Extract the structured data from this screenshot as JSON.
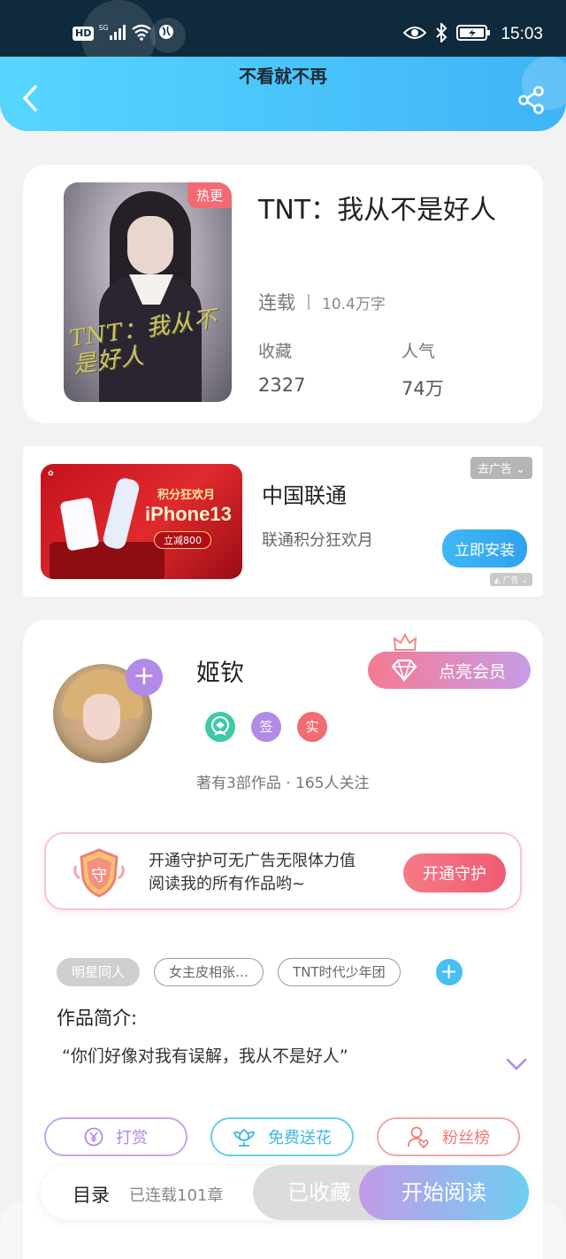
{
  "status_bar": {
    "hd": "HD",
    "network": "5G",
    "time": "15:03"
  },
  "header": {
    "title": "不看就不再"
  },
  "book": {
    "cover_badge": "热更",
    "cover_calligraphy": "TNT：我从不是好人",
    "title": "TNT：我从不是好人",
    "status": "连载",
    "word_count": "10.4万字",
    "fav_label": "收藏",
    "fav_value": "2327",
    "pop_label": "人气",
    "pop_value": "74万"
  },
  "ad": {
    "image_line1": "积分狂欢月",
    "image_line2": "iPhone13",
    "image_line3": "立减800",
    "name": "中国联通",
    "desc": "联通积分狂欢月",
    "close_label": "去广告",
    "install_label": "立即安装",
    "ad_mark": "广告"
  },
  "author": {
    "name": "姬钦",
    "badge_sign": "签",
    "badge_real": "实",
    "meta": "著有3部作品 · 165人关注",
    "vip_label": "点亮会员",
    "guard_icon": "守",
    "guard_line1": "开通守护可无广告无限体力值",
    "guard_line2": "阅读我的所有作品哟~",
    "guard_button": "开通守护"
  },
  "tags": [
    "明星同人",
    "女主皮相张…",
    "TNT时代少年团"
  ],
  "intro": {
    "heading": "作品简介:",
    "text": "“你们好像对我有误解，我从不是好人”"
  },
  "actions": {
    "tip": "打赏",
    "flower": "免费送花",
    "fans": "粉丝榜"
  },
  "bottom": {
    "toc": "目录",
    "chapters": "已连载101章",
    "favorited": "已收藏",
    "start_reading": "开始阅读"
  },
  "colors": {
    "header_gradient_start": "#56d6ff",
    "header_gradient_end": "#3fb4f6",
    "accent_purple": "#b18ae4",
    "accent_pink": "#f57a91",
    "accent_blue": "#47bff5"
  }
}
